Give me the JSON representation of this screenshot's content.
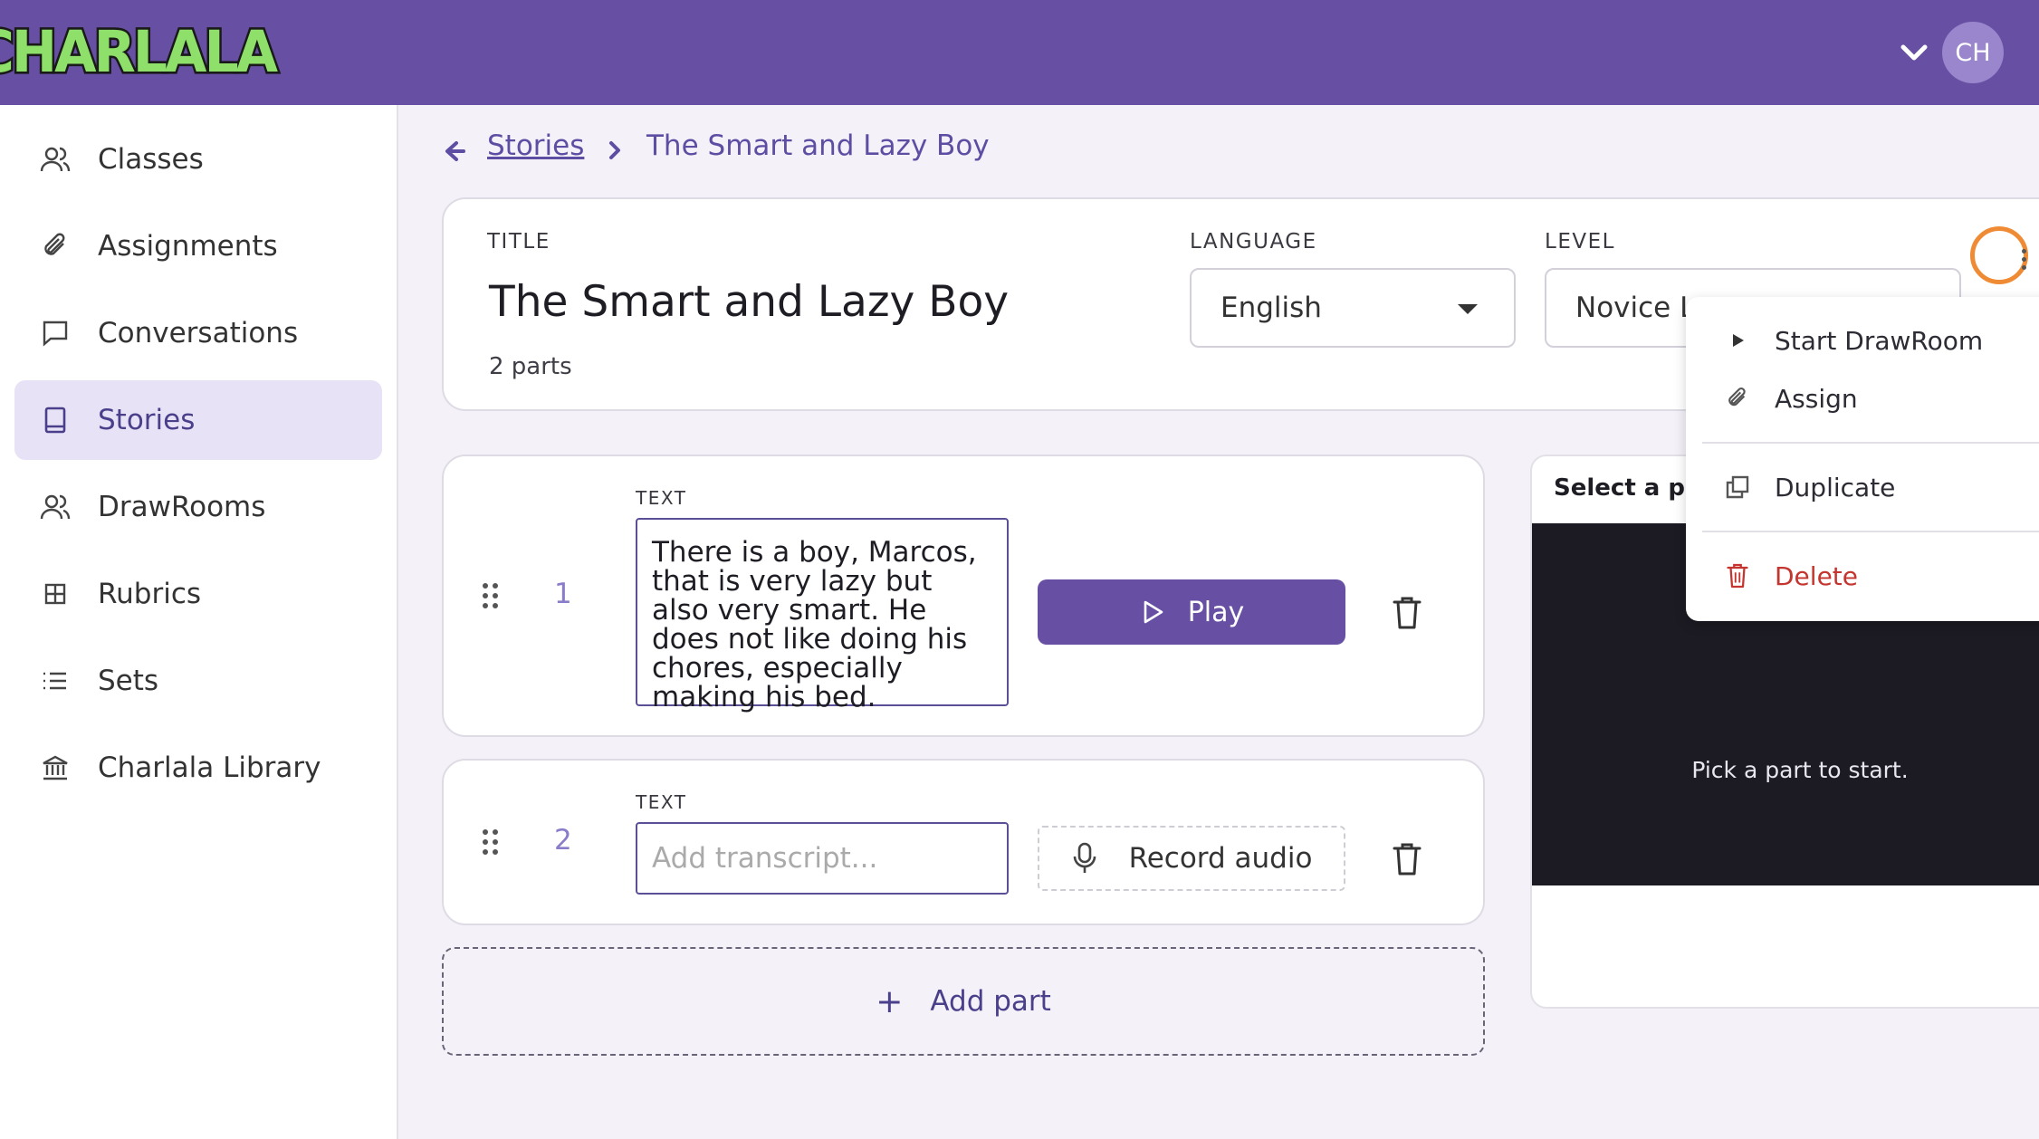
{
  "app": {
    "logo_text": "CHARLALA",
    "avatar_initials": "CH"
  },
  "sidebar": {
    "items": [
      {
        "label": "Classes",
        "icon": "users-icon"
      },
      {
        "label": "Assignments",
        "icon": "paperclip-icon"
      },
      {
        "label": "Conversations",
        "icon": "chat-icon"
      },
      {
        "label": "Stories",
        "icon": "book-icon",
        "active": true
      },
      {
        "label": "DrawRooms",
        "icon": "users-icon"
      },
      {
        "label": "Rubrics",
        "icon": "grid-icon"
      },
      {
        "label": "Sets",
        "icon": "list-icon"
      },
      {
        "label": "Charlala Library",
        "icon": "library-icon"
      }
    ]
  },
  "breadcrumb": {
    "parent": "Stories",
    "current": "The Smart and Lazy Boy"
  },
  "story": {
    "title_label": "TITLE",
    "title": "The Smart and Lazy Boy",
    "parts_count": "2 parts",
    "language_label": "LANGUAGE",
    "language_value": "English",
    "level_label": "LEVEL",
    "level_value": "Novice L"
  },
  "menu": {
    "items": [
      {
        "label": "Start DrawRoom",
        "icon": "play-triangle-icon"
      },
      {
        "label": "Assign",
        "icon": "paperclip-icon"
      },
      {
        "label": "Duplicate",
        "icon": "duplicate-icon"
      },
      {
        "label": "Delete",
        "icon": "trash-icon",
        "danger": true
      }
    ]
  },
  "parts": [
    {
      "number": "1",
      "text_label": "TEXT",
      "text": "There is a boy, Marcos, that is very lazy but also very smart. He does not like doing his chores, especially making his bed.",
      "action_label": "Play"
    },
    {
      "number": "2",
      "text_label": "TEXT",
      "placeholder": "Add transcript...",
      "action_label": "Record audio"
    }
  ],
  "add_part_label": "Add part",
  "preview": {
    "header": "Select a par",
    "message": "Pick a part to start."
  },
  "colors": {
    "brand": "#6750a4",
    "active_nav_bg": "#e8e2f6",
    "danger": "#c5352f",
    "highlight_ring": "#ef8a35"
  }
}
